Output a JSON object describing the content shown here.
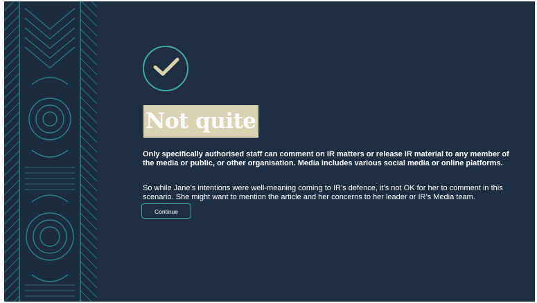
{
  "feedback": {
    "status_icon": "check-icon",
    "title": "Not quite",
    "bold_message": "Only specifically authorised staff can comment on IR matters or release IR material to any member of the media or public, or other organisation. Media includes various social media or online platforms.",
    "message": "So while Jane’s intentions were well-meaning coming to IR’s defence, it’s not OK for her to comment in this scenario. She might want to mention the article and her concerns to her leader or IR’s Media team.",
    "continue_label": "Continue"
  },
  "colors": {
    "background": "#1f2f41",
    "accent": "#3fa8a8",
    "check": "#d9d3b1",
    "title_highlight": "#d9d3b1"
  }
}
